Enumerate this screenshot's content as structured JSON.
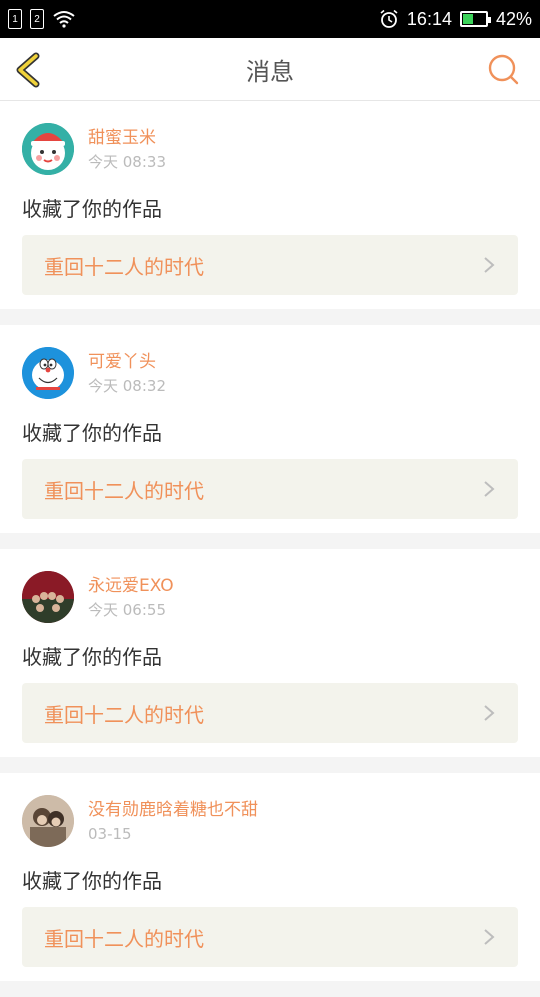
{
  "status_bar": {
    "sim1": "1",
    "sim2": "2",
    "time": "16:14",
    "battery_percent": "42%",
    "battery_level": 0.42,
    "icons": [
      "sim-card-icon",
      "sim-card-icon",
      "wifi-icon",
      "alarm-icon",
      "battery-icon"
    ]
  },
  "header": {
    "title": "消息",
    "back_icon": "chevron-left-icon",
    "search_icon": "search-icon",
    "accent": "#f0b323"
  },
  "colors": {
    "orange": "#f0915a",
    "link_bg": "#f3f3ec",
    "page_bg": "#f4f4f4"
  },
  "messages": [
    {
      "username": "甜蜜玉米",
      "time": "今天 08:33",
      "action": "收藏了你的作品",
      "work_title": "重回十二人的时代"
    },
    {
      "username": "可爱丫头",
      "time": "今天 08:32",
      "action": "收藏了你的作品",
      "work_title": "重回十二人的时代"
    },
    {
      "username": "永远爱EXO",
      "time": "今天 06:55",
      "action": "收藏了你的作品",
      "work_title": "重回十二人的时代"
    },
    {
      "username": "没有勋鹿晗着糖也不甜",
      "time": "03-15",
      "action": "收藏了你的作品",
      "work_title": "重回十二人的时代"
    }
  ]
}
